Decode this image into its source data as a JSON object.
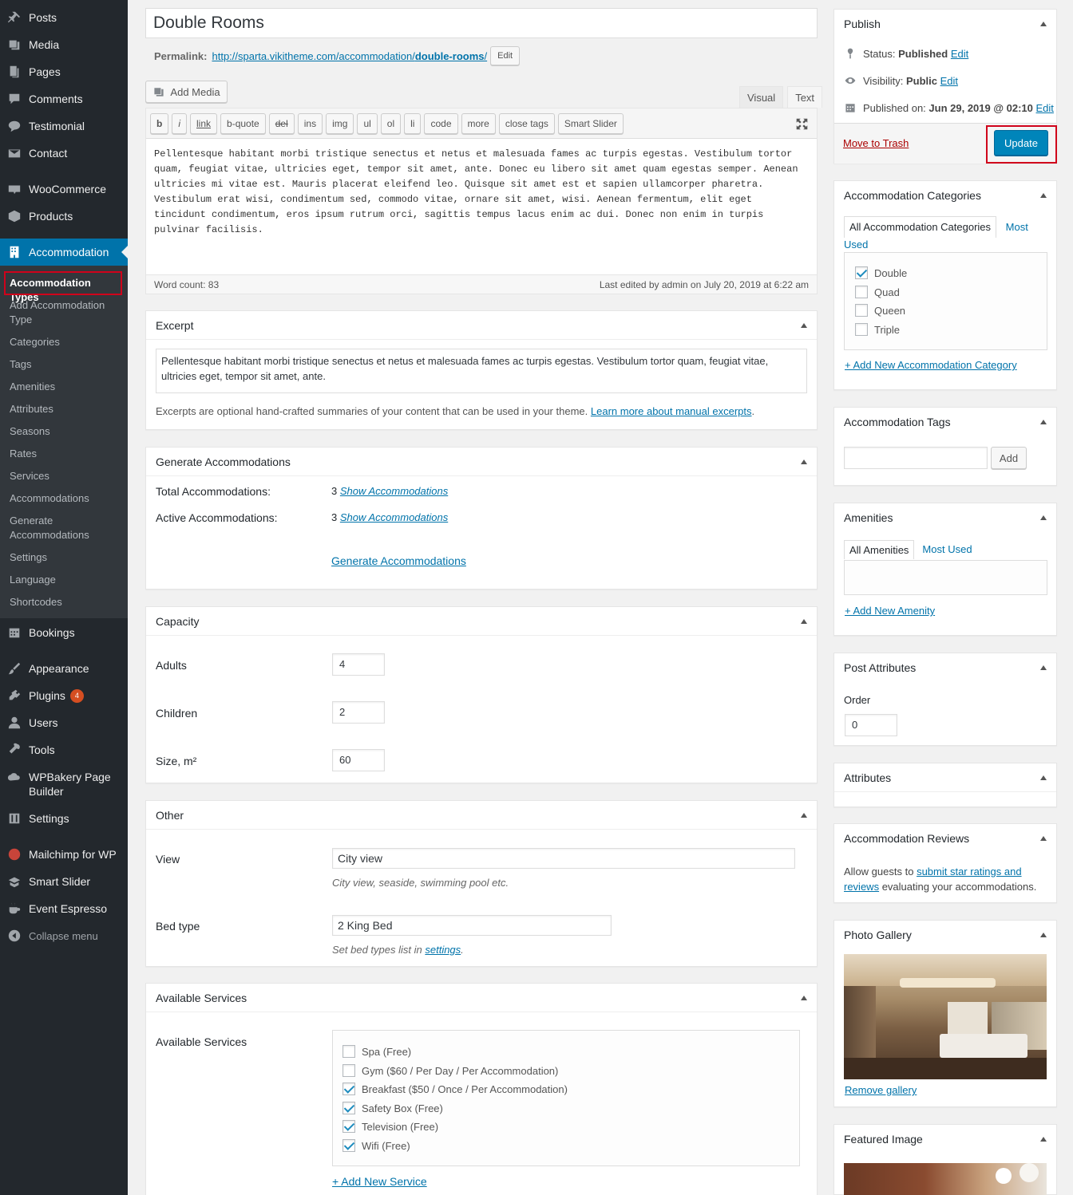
{
  "sidebar": {
    "menu": [
      {
        "label": "Posts",
        "icon": "pin-icon"
      },
      {
        "label": "Media",
        "icon": "media-icon"
      },
      {
        "label": "Pages",
        "icon": "pages-icon"
      },
      {
        "label": "Comments",
        "icon": "comments-icon"
      },
      {
        "label": "Testimonial",
        "icon": "testimonial-icon"
      },
      {
        "label": "Contact",
        "icon": "mail-icon"
      },
      {
        "label": "WooCommerce",
        "icon": "woo-icon"
      },
      {
        "label": "Products",
        "icon": "products-icon"
      },
      {
        "label": "Accommodation",
        "icon": "building-icon"
      },
      {
        "label": "Bookings",
        "icon": "calendar-icon"
      },
      {
        "label": "Appearance",
        "icon": "brush-icon"
      },
      {
        "label": "Plugins",
        "icon": "plugin-icon",
        "badge": "4"
      },
      {
        "label": "Users",
        "icon": "user-icon"
      },
      {
        "label": "Tools",
        "icon": "wrench-icon"
      },
      {
        "label": "WPBakery Page Builder",
        "icon": "cloud-icon"
      },
      {
        "label": "Settings",
        "icon": "sliders-icon"
      },
      {
        "label": "Mailchimp for WP",
        "icon": "mailchimp-icon"
      },
      {
        "label": "Smart Slider",
        "icon": "slider-icon"
      },
      {
        "label": "Event Espresso",
        "icon": "coffee-icon"
      }
    ],
    "collapse_label": "Collapse menu",
    "submenu": [
      "Accommodation Types",
      "Add Accommodation Type",
      "Categories",
      "Tags",
      "Amenities",
      "Attributes",
      "Seasons",
      "Rates",
      "Services",
      "Accommodations",
      "Generate Accommodations",
      "Settings",
      "Language",
      "Shortcodes"
    ]
  },
  "post": {
    "title": "Double Rooms",
    "permalink_label": "Permalink:",
    "permalink_base": "http://sparta.vikitheme.com/accommodation/",
    "permalink_slug": "double-rooms",
    "permalink_end": "/",
    "permalink_edit": "Edit"
  },
  "editor": {
    "add_media": "Add Media",
    "tab_visual": "Visual",
    "tab_text": "Text",
    "buttons": [
      "b",
      "i",
      "link",
      "b-quote",
      "del",
      "ins",
      "img",
      "ul",
      "ol",
      "li",
      "code",
      "more",
      "close tags",
      "Smart Slider"
    ],
    "content": "Pellentesque habitant morbi tristique senectus et netus et malesuada fames ac turpis egestas. Vestibulum tortor quam, feugiat vitae, ultricies eget, tempor sit amet, ante. Donec eu libero sit amet quam egestas semper. Aenean ultricies mi vitae est. Mauris placerat eleifend leo. Quisque sit amet est et sapien ullamcorper pharetra. Vestibulum erat wisi, condimentum sed, commodo vitae, ornare sit amet, wisi. Aenean fermentum, elit eget tincidunt condimentum, eros ipsum rutrum orci, sagittis tempus lacus enim ac dui. Donec non enim in turpis pulvinar facilisis.",
    "word_count": "Word count: 83",
    "last_edited": "Last edited by admin on July 20, 2019 at 6:22 am"
  },
  "excerpt": {
    "title": "Excerpt",
    "value": "Pellentesque habitant morbi tristique senectus et netus et malesuada fames ac turpis egestas. Vestibulum tortor quam, feugiat vitae, ultricies eget, tempor sit amet, ante.",
    "help_text": "Excerpts are optional hand-crafted summaries of your content that can be used in your theme.",
    "help_link": "Learn more about manual excerpts",
    "help_end": "."
  },
  "generate": {
    "title": "Generate Accommodations",
    "total_label": "Total Accommodations:",
    "total_value": "3",
    "active_label": "Active Accommodations:",
    "active_value": "3",
    "show_link": "Show Accommodations",
    "generate_link": "Generate Accommodations"
  },
  "capacity": {
    "title": "Capacity",
    "adults_label": "Adults",
    "adults_value": "4",
    "children_label": "Children",
    "children_value": "2",
    "size_label": "Size, m²",
    "size_value": "60"
  },
  "other": {
    "title": "Other",
    "view_label": "View",
    "view_value": "City view",
    "view_desc": "City view, seaside, swimming pool etc.",
    "bed_label": "Bed type",
    "bed_value": "2 King Bed",
    "bed_desc": "Set bed types list in",
    "bed_desc_link": "settings",
    "bed_desc_end": "."
  },
  "services": {
    "title": "Available Services",
    "label": "Available Services",
    "items": [
      {
        "label": "Spa (Free)",
        "checked": false
      },
      {
        "label": "Gym ($60 / Per Day / Per Accommodation)",
        "checked": false
      },
      {
        "label": "Breakfast ($50 / Once / Per Accommodation)",
        "checked": true
      },
      {
        "label": "Safety Box (Free)",
        "checked": true
      },
      {
        "label": "Television (Free)",
        "checked": true
      },
      {
        "label": "Wifi (Free)",
        "checked": true
      }
    ],
    "add_link": "+ Add New Service"
  },
  "publish": {
    "title": "Publish",
    "status_label": "Status:",
    "status_value": "Published",
    "visibility_label": "Visibility:",
    "visibility_value": "Public",
    "published_label": "Published on:",
    "published_value": "Jun 29, 2019 @ 02:10",
    "edit": "Edit",
    "trash": "Move to Trash",
    "update": "Update"
  },
  "acc_categories": {
    "title": "Accommodation Categories",
    "tab_all": "All Accommodation Categories",
    "tab_most_used_1": "Most",
    "tab_most_used_2": "Used",
    "items": [
      {
        "label": "Double",
        "checked": true
      },
      {
        "label": "Quad",
        "checked": false
      },
      {
        "label": "Queen",
        "checked": false
      },
      {
        "label": "Triple",
        "checked": false
      }
    ],
    "add_link": "+ Add New Accommodation Category"
  },
  "acc_tags": {
    "title": "Accommodation Tags",
    "add_button": "Add"
  },
  "amenities": {
    "title": "Amenities",
    "tab_all": "All Amenities",
    "tab_most_used": "Most Used",
    "add_link": "+ Add New Amenity"
  },
  "post_attributes": {
    "title": "Post Attributes",
    "order_label": "Order",
    "order_value": "0"
  },
  "attributes": {
    "title": "Attributes"
  },
  "reviews": {
    "title": "Accommodation Reviews",
    "text_start": "Allow guests to",
    "link1": "submit star ratings and",
    "link2": "reviews",
    "text_end": "evaluating your accommodations."
  },
  "gallery": {
    "title": "Photo Gallery",
    "remove_link": "Remove gallery"
  },
  "featured": {
    "title": "Featured Image"
  },
  "colors": {
    "admin_dark": "#23282d",
    "admin_accent": "#0073aa",
    "primary_button": "#0085ba",
    "highlight_red": "#d0021b"
  }
}
